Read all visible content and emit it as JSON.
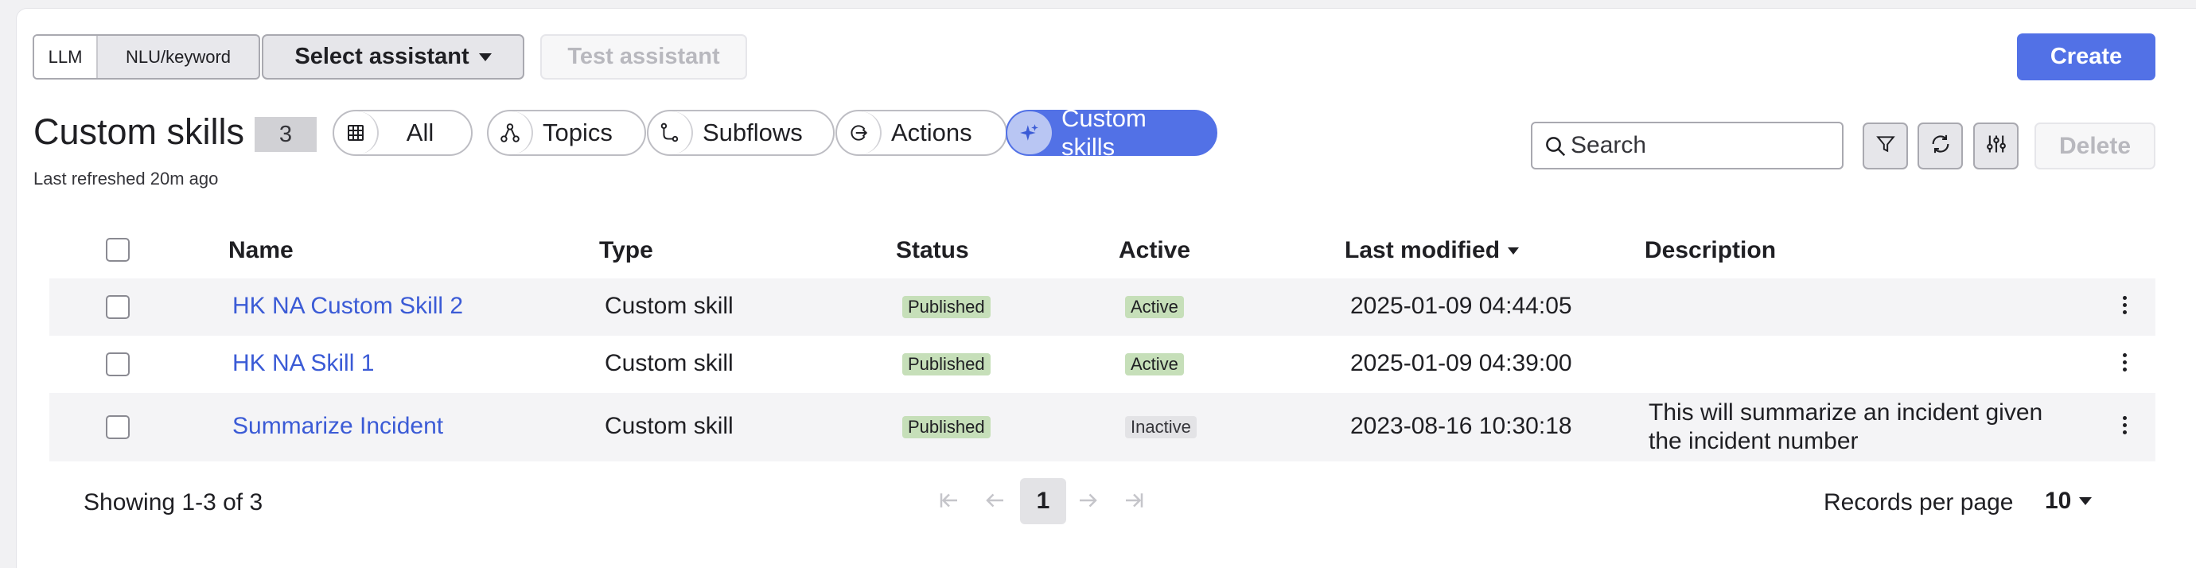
{
  "toolbar": {
    "mode_llm": "LLM",
    "mode_nlu": "NLU/keyword",
    "select_assistant": "Select assistant",
    "test_assistant": "Test assistant",
    "create": "Create"
  },
  "header": {
    "title": "Custom skills",
    "count": "3",
    "last_refreshed": "Last refreshed 20m ago"
  },
  "filters": {
    "all": "All",
    "topics": "Topics",
    "subflows": "Subflows",
    "actions": "Actions",
    "custom_skills": "Custom skills"
  },
  "search": {
    "placeholder": "Search"
  },
  "actions": {
    "delete": "Delete"
  },
  "table": {
    "columns": [
      "Name",
      "Type",
      "Status",
      "Active",
      "Last modified",
      "Description"
    ],
    "rows": [
      {
        "name": "HK NA Custom Skill 2",
        "type": "Custom skill",
        "status": "Published",
        "active": "Active",
        "modified": "2025-01-09 04:44:05",
        "description": ""
      },
      {
        "name": "HK NA Skill 1",
        "type": "Custom skill",
        "status": "Published",
        "active": "Active",
        "modified": "2025-01-09 04:39:00",
        "description": ""
      },
      {
        "name": "Summarize Incident",
        "type": "Custom skill",
        "status": "Published",
        "active": "Inactive",
        "modified": "2023-08-16 10:30:18",
        "description": "This will summarize an incident given the incident number"
      }
    ]
  },
  "footer": {
    "showing": "Showing 1-3 of 3",
    "current_page": "1",
    "records_per_page_label": "Records per page",
    "records_per_page_value": "10"
  },
  "colors": {
    "accent": "#5271e6",
    "link": "#3b5bd6",
    "published_tag": "#c6dfb9",
    "inactive_tag": "#e3e3e6"
  },
  "icons": [
    "table-icon",
    "topics-icon",
    "subflows-icon",
    "actions-icon",
    "sparkle-icon",
    "search-icon",
    "filter-icon",
    "refresh-icon",
    "settings-sliders-icon",
    "kebab-icon"
  ]
}
